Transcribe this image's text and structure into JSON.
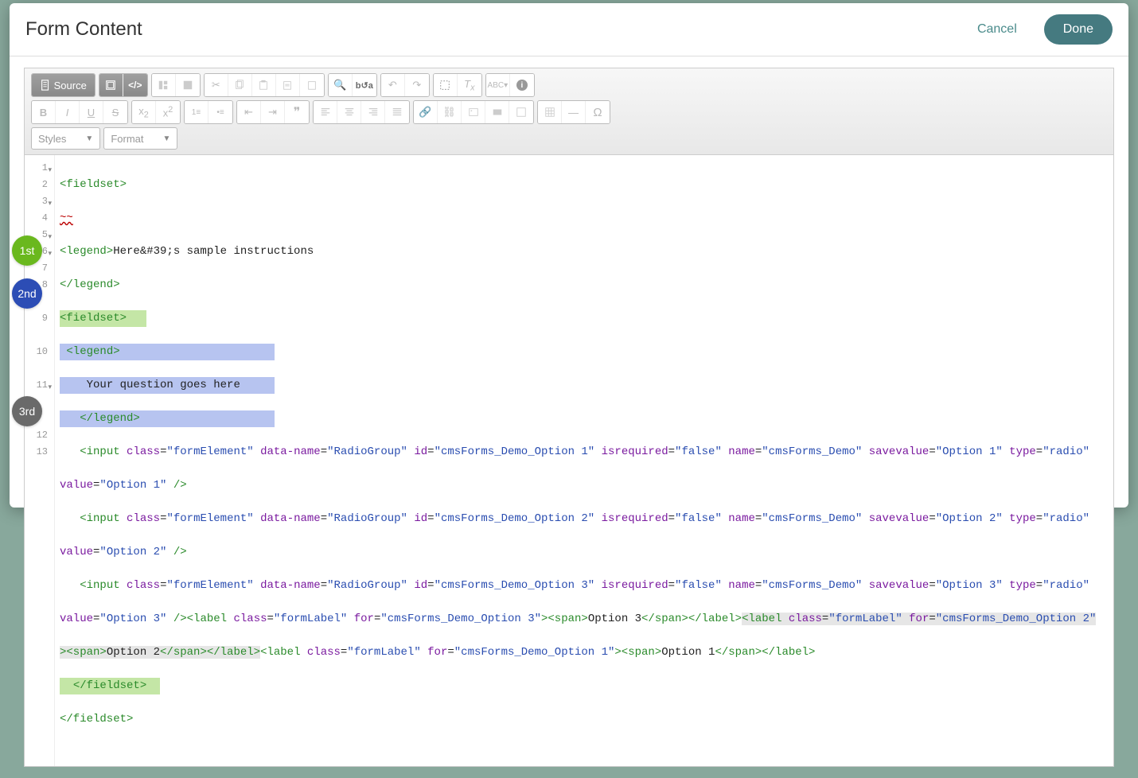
{
  "modal": {
    "title": "Form Content",
    "cancel": "Cancel",
    "done": "Done"
  },
  "toolbar": {
    "source": "Source",
    "styles": "Styles",
    "format": "Format"
  },
  "badges": {
    "first": "1st",
    "second": "2nd",
    "third": "3rd"
  },
  "code": {
    "l1": {
      "open": "<fieldset>"
    },
    "l2_err": "~~",
    "l3": {
      "open": "<legend>",
      "text": "Here&#39;s sample instructions"
    },
    "l4": "</legend>",
    "l5": "<fieldset>",
    "l6": {
      "open": "<legend>"
    },
    "l7_text": "Your question goes here",
    "l8": "</legend>",
    "l9": {
      "pre": "   ",
      "tag": "<input",
      "a1n": "class",
      "a1v": "\"formElement\"",
      "a2n": "data-name",
      "a2v": "\"RadioGroup\"",
      "a3n": "id",
      "a3v": "\"cmsForms_Demo_Option 1\"",
      "a4n": "isrequired",
      "a4v": "\"false\"",
      "a5n": "name",
      "a5v": "\"cmsForms_Demo\"",
      "a6n": "savevalue",
      "a6v": "\"Option 1\"",
      "a7n": "type",
      "a7v": "\"radio\"",
      "a8n": "value",
      "a8v": "\"Option 1\"",
      "close": " />"
    },
    "l10": {
      "pre": "   ",
      "tag": "<input",
      "a1n": "class",
      "a1v": "\"formElement\"",
      "a2n": "data-name",
      "a2v": "\"RadioGroup\"",
      "a3n": "id",
      "a3v": "\"cmsForms_Demo_Option 2\"",
      "a4n": "isrequired",
      "a4v": "\"false\"",
      "a5n": "name",
      "a5v": "\"cmsForms_Demo\"",
      "a6n": "savevalue",
      "a6v": "\"Option 2\"",
      "a7n": "type",
      "a7v": "\"radio\"",
      "a8n": "value",
      "a8v": "\"Option 2\"",
      "close": " />"
    },
    "l11a": {
      "pre": "   ",
      "tag": "<input",
      "a1n": "class",
      "a1v": "\"formElement\"",
      "a2n": "data-name",
      "a2v": "\"RadioGroup\"",
      "a3n": "id",
      "a3v": "\"cmsForms_Demo_Option 3\"",
      "a4n": "isrequired",
      "a4v": "\"false\"",
      "a5n": "name",
      "a5v": "\"cmsForms_Demo\"",
      "a6n": "savevalue",
      "a6v": "\"Option 3\"",
      "a7n": "type",
      "a7v": "\"radio\"",
      "a8n": "value",
      "a8v": "\"Option 3\"",
      "close": " />"
    },
    "label3": {
      "open": "<label",
      "a1n": "class",
      "a1v": "\"formLabel\"",
      "a2n": "for",
      "a2v": "\"cmsForms_Demo_Option 3\"",
      "mid": "><span>",
      "text": "Option 3",
      "end": "</span></label>"
    },
    "label2": {
      "open": "<label",
      "a1n": "class",
      "a1v": "\"formLabel\"",
      "a2n": "for",
      "a2v": "\"cmsForms_Demo_Option 2\"",
      "mid": "><span>",
      "text": "Option 2",
      "end": "</span></label>"
    },
    "label1": {
      "open": "<label",
      "a1n": "class",
      "a1v": "\"formLabel\"",
      "a2n": "for",
      "a2v": "\"cmsForms_Demo_Option 1\"",
      "mid": "><span>",
      "text": "Option 1",
      "end": "</span></label>"
    },
    "l12": "  </fieldset>",
    "l13": "</fieldset>"
  },
  "gutter": [
    "1",
    "2",
    "3",
    "4",
    "5",
    "6",
    "7",
    "8",
    "",
    "9",
    "",
    "10",
    "",
    "11",
    "",
    "",
    "12",
    "13"
  ]
}
